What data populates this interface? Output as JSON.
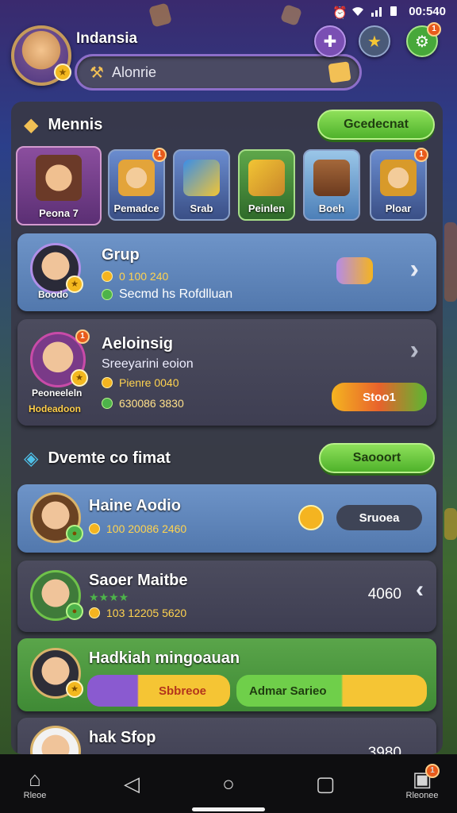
{
  "status_bar": {
    "time": "00:540"
  },
  "header": {
    "username": "Indansia",
    "search_label": "Alonrie",
    "notification_count": "1"
  },
  "sections": {
    "menu": {
      "title": "Mennis",
      "button": "Gcedecnat"
    },
    "categories": [
      {
        "label": "Peona 7",
        "badge": ""
      },
      {
        "label": "Pemadce",
        "badge": "1"
      },
      {
        "label": "Srab",
        "badge": ""
      },
      {
        "label": "Peinlen",
        "badge": ""
      },
      {
        "label": "Boeh",
        "badge": ""
      },
      {
        "label": "Ploar",
        "badge": "1"
      }
    ],
    "featured": {
      "title": "Dvemte co fimat",
      "button": "Saooort"
    }
  },
  "cards": [
    {
      "name": "Grup",
      "avatar_label": "Boodo",
      "stat1": "0 100 240",
      "stat2": "Secmd hs Rofdlluan",
      "badge": ""
    },
    {
      "name": "Aeloinsig",
      "avatar_label": "Peoneeleln",
      "avatar_label2": "Hodeadoon",
      "subtitle": "Sreeyarini eoion",
      "stat1": "Pienre 0040",
      "stat2": "630086 3830",
      "action": "Stoo1",
      "badge": "1"
    },
    {
      "name": "Haine Aodio",
      "stat1": "100 20086 2460",
      "action": "Sruoea"
    },
    {
      "name": "Saoer Maitbe",
      "stat1": "103 12205 5620",
      "value": "4060"
    },
    {
      "name": "Hadkiah mingoauan",
      "btn_left": "Sbbreoe",
      "btn_right": "Admar Sarieo"
    },
    {
      "name": "hak Sfop",
      "value": "3980"
    }
  ],
  "navbar": {
    "home_label": "Rleoe",
    "records_label": "Rleonee",
    "records_badge": "1"
  },
  "colors": {
    "accent_green": "#5fc23a",
    "accent_purple": "#8d6ec9",
    "coin_gold": "#f4b420"
  }
}
